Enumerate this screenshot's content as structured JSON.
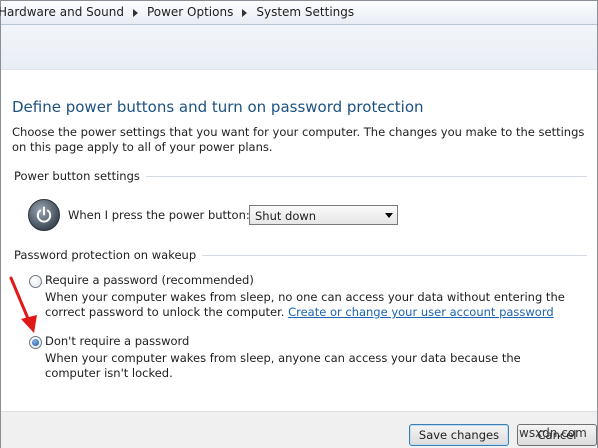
{
  "breadcrumb": {
    "items": [
      "Hardware and Sound",
      "Power Options",
      "System Settings"
    ]
  },
  "page": {
    "title": "Define power buttons and turn on password protection",
    "intro": "Choose the power settings that you want for your computer. The changes you make to the settings on this page apply to all of your power plans."
  },
  "power_buttons": {
    "group_title": "Power button settings",
    "label": "When I press the power button:",
    "selected": "Shut down",
    "icon": "power-icon"
  },
  "password": {
    "group_title": "Password protection on wakeup",
    "option1_label": "Require a password (recommended)",
    "option1_desc": "When your computer wakes from sleep, no one can access your data without entering the correct password to unlock the computer.",
    "option1_link": "Create or change your user account password",
    "option2_label": "Don't require a password",
    "option2_desc": "When your computer wakes from sleep, anyone can access your data because the computer isn't locked.",
    "selected_option": 2
  },
  "footer": {
    "save_label": "Save changes",
    "cancel_label": "Cancel"
  },
  "watermark": "wsxdn.com",
  "colors": {
    "title": "#1c5180",
    "link": "#1a63b5",
    "annotation_arrow": "#e01818"
  }
}
